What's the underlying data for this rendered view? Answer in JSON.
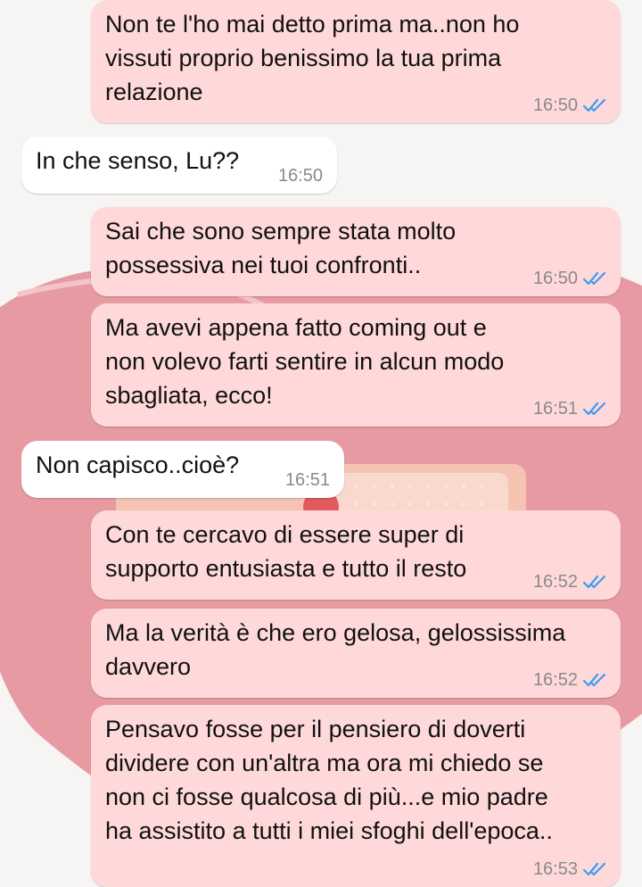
{
  "colors": {
    "outgoing_bubble": "#ffd9d9",
    "incoming_bubble": "#ffffff",
    "read_ticks": "#3b9cf3",
    "timestamp": "#8a8a8a",
    "wallpaper_heart": "#e79aa1"
  },
  "messages": [
    {
      "direction": "out",
      "text": "Non te l'ho mai detto prima ma..non ho\nvissuti proprio benissimo la tua prima\nrelazione",
      "time": "16:50",
      "status_icon": "double-check-read-icon"
    },
    {
      "direction": "in",
      "text": "In che senso, Lu??",
      "time": "16:50"
    },
    {
      "direction": "out",
      "text": "Sai che sono sempre stata molto\npossessiva nei tuoi confronti..",
      "time": "16:50",
      "status_icon": "double-check-read-icon"
    },
    {
      "direction": "out",
      "text": "Ma avevi appena fatto coming out e\nnon volevo farti sentire in alcun modo\nsbagliata, ecco!",
      "time": "16:51",
      "status_icon": "double-check-read-icon"
    },
    {
      "direction": "in",
      "text": "Non capisco..cioè?",
      "time": "16:51"
    },
    {
      "direction": "out",
      "text": "Con te cercavo di essere super di\nsupporto entusiasta e tutto il resto",
      "time": "16:52",
      "status_icon": "double-check-read-icon"
    },
    {
      "direction": "out",
      "text": "Ma la verità è che ero gelosa, gelossissima\ndavvero",
      "time": "16:52",
      "status_icon": "double-check-read-icon"
    },
    {
      "direction": "out",
      "text": "Pensavo fosse per il pensiero di doverti\ndividere con un'altra ma ora mi chiedo se\nnon ci fosse qualcosa di più...e mio padre\nha assistito a tutti i miei sfoghi dell'epoca..",
      "time": "16:53",
      "status_icon": "double-check-read-icon"
    }
  ]
}
